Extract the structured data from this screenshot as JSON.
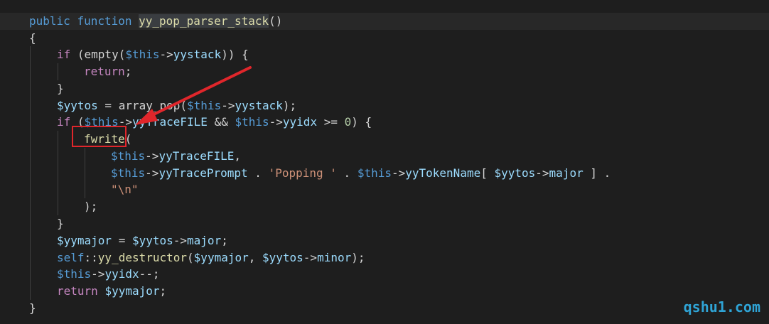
{
  "code": {
    "l1": {
      "kw1": "public",
      "kw2": "function",
      "name": "yy_pop_parser_stack",
      "tail": "()"
    },
    "l2": "{",
    "l3": {
      "if": "if",
      "rest1": " (empty(",
      "this": "$this",
      "arrow": "->",
      "prop": "yystack",
      "tail": ")) {"
    },
    "l4": {
      "ret": "return",
      "tail": ";"
    },
    "l5": "}",
    "l6": {
      "var": "$yytos",
      "mid": " = array_pop(",
      "this": "$this",
      "arrow": "->",
      "prop": "yystack",
      "tail": ");"
    },
    "l7": {
      "if": "if",
      "p1": " (",
      "this1": "$this",
      "a1": "->",
      "prop1": "yyTraceFILE",
      "and": " && ",
      "this2": "$this",
      "a2": "->",
      "prop2": "yyidx",
      "cmp": " >= ",
      "num": "0",
      "tail": ") {"
    },
    "l8": {
      "fn": "fwrite",
      "tail": "("
    },
    "l9": {
      "this": "$this",
      "arrow": "->",
      "prop": "yyTraceFILE",
      "tail": ","
    },
    "l10": {
      "this1": "$this",
      "a1": "->",
      "prop1": "yyTracePrompt",
      "dot1": " . ",
      "str": "'Popping '",
      "dot2": " . ",
      "this2": "$this",
      "a2": "->",
      "prop2": "yyTokenName",
      "br": "[ ",
      "var": "$yytos",
      "a3": "->",
      "prop3": "major",
      "end": " ] ."
    },
    "l11": {
      "str": "\"\\n\""
    },
    "l12": ");",
    "l13": "}",
    "l14": {
      "var1": "$yymajor",
      "mid": " = ",
      "var2": "$yytos",
      "arrow": "->",
      "prop": "major",
      "tail": ";"
    },
    "l15": {
      "self": "self",
      "dc": "::",
      "fn": "yy_destructor",
      "p": "(",
      "var1": "$yymajor",
      "comma": ", ",
      "var2": "$yytos",
      "arrow": "->",
      "prop": "minor",
      "tail": ");"
    },
    "l16": {
      "this": "$this",
      "arrow": "->",
      "prop": "yyidx",
      "tail": "--;"
    },
    "l17": {
      "ret": "return",
      "sp": " ",
      "var": "$yymajor",
      "tail": ";"
    },
    "l18": "}"
  },
  "watermark": "qshu1.com",
  "colors": {
    "background": "#1e1e1e",
    "annotation": "#e0262b",
    "watermark": "#2fa4d6"
  }
}
